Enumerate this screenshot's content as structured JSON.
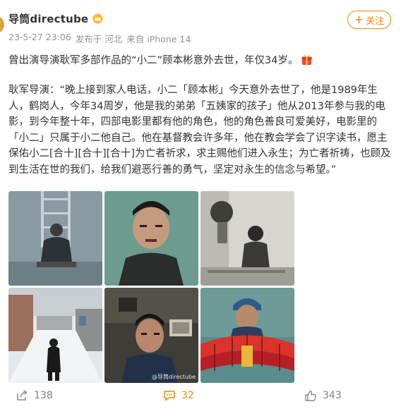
{
  "post": {
    "author": "导筒directube",
    "meta": {
      "date": "23-5-27 23:06",
      "location": "发布于 河北",
      "source": "来自 iPhone 14"
    },
    "follow_label": "关注",
    "title_line": "曾出演导演耿军多部作品的“小二”顾本彬意外去世，年仅34岁。",
    "quote": "耿军导演：“晚上接到家人电话，小二「顾本彬」今天意外去世了，他是1989年生人，鹤岗人，今年34周岁，他是我的弟弟「五姨家的孩子」他从2013年参与我的电影，到今年整十年，四部电影里都有他的角色，他的角色善良可爱美好，电影里的「小二」只属于小二他自己。他在基督教会许多年，他在教会学会了识字读书，愿主保佑小二[合十][合十][合十]为亡者祈求，求主赐他们进入永生；为亡者祈祷，也顾及到生活在世的我们，给我们避恶行善的勇气，坚定对永生的信念与希望。”",
    "image_watermark": "@导筒directube"
  },
  "actions": {
    "share_count": "138",
    "comment_count": "32",
    "like_count": "343"
  },
  "icons": {
    "vip": "crown-badge-icon",
    "gift": "red-gift-icon",
    "share": "share-icon",
    "comment": "comment-icon",
    "like": "thumbs-up-icon"
  },
  "colors": {
    "accent": "#ff8200",
    "meta_text": "#939393",
    "body_text": "#333333"
  }
}
